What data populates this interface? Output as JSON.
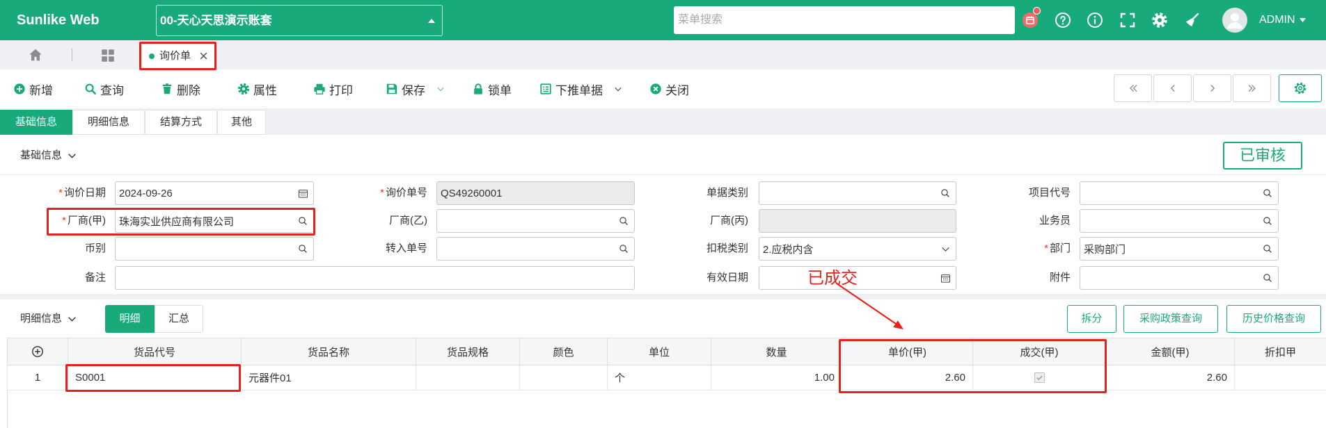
{
  "header": {
    "logo": "Sunlike Web",
    "account": "00-天心天思演示账套",
    "search_placeholder": "菜单搜索",
    "user": "ADMIN",
    "icons": [
      "calendar-notification-icon",
      "help-icon",
      "info-icon",
      "fullscreen-icon",
      "gear-icon",
      "broom-icon",
      "avatar-icon"
    ]
  },
  "tabs": [
    {
      "label": "询价单",
      "active": true
    }
  ],
  "toolbar": {
    "items": [
      {
        "label": "新增",
        "icon": "plus-circle-icon"
      },
      {
        "label": "查询",
        "icon": "search-icon"
      },
      {
        "label": "删除",
        "icon": "trash-icon"
      },
      {
        "label": "属性",
        "icon": "gear-icon"
      },
      {
        "label": "打印",
        "icon": "printer-icon"
      },
      {
        "label": "保存",
        "icon": "save-icon",
        "dropdown": true
      },
      {
        "label": "锁单",
        "icon": "lock-icon"
      },
      {
        "label": "下推单据",
        "icon": "document-list-icon",
        "dropdown": true
      },
      {
        "label": "关闭",
        "icon": "close-circle-icon"
      }
    ],
    "nav_icons": [
      "double-left-icon",
      "left-icon",
      "right-icon",
      "double-right-icon"
    ],
    "settings_icon": "gear-icon"
  },
  "form_tabs": [
    {
      "label": "基础信息",
      "active": true
    },
    {
      "label": "明细信息",
      "active": false
    },
    {
      "label": "结算方式",
      "active": false
    },
    {
      "label": "其他",
      "active": false
    }
  ],
  "basic": {
    "section_title": "基础信息",
    "status": "已审核",
    "required_mark": "*",
    "rows": [
      [
        {
          "label": "询价日期",
          "required": true,
          "value": "2024-09-26",
          "icon": "calendar-icon"
        },
        {
          "label": "询价单号",
          "required": true,
          "value": "QS49260001",
          "readonly": true
        },
        {
          "label": "单据类别",
          "value": "",
          "icon": "search-icon"
        },
        {
          "label": "项目代号",
          "value": "",
          "icon": "search-icon"
        }
      ],
      [
        {
          "label": "厂商(甲)",
          "required": true,
          "value": "珠海实业供应商有限公司",
          "icon": "search-icon"
        },
        {
          "label": "厂商(乙)",
          "value": "",
          "icon": "search-icon"
        },
        {
          "label": "厂商(丙)",
          "value": "",
          "readonly": true
        },
        {
          "label": "业务员",
          "value": "",
          "icon": "search-icon"
        }
      ],
      [
        {
          "label": "币别",
          "value": "",
          "icon": "search-icon"
        },
        {
          "label": "转入单号",
          "value": "",
          "icon": "search-icon"
        },
        {
          "label": "扣税类别",
          "value": "2.应税内含",
          "icon": "chevron-down-icon"
        },
        {
          "label": "部门",
          "required": true,
          "value": "采购部门",
          "icon": "search-icon"
        }
      ],
      [
        {
          "label": "备注",
          "value": ""
        },
        {
          "label": "有效日期",
          "value": "",
          "icon": "calendar-icon"
        },
        {
          "label": "附件",
          "value": "",
          "icon": "search-icon"
        }
      ]
    ]
  },
  "detail": {
    "section_title": "明细信息",
    "views": [
      {
        "label": "明细",
        "active": true
      },
      {
        "label": "汇总",
        "active": false
      }
    ],
    "actions": [
      "拆分",
      "采购政策查询",
      "历史价格查询"
    ],
    "columns": [
      "货品代号",
      "货品名称",
      "货品规格",
      "颜色",
      "单位",
      "数量",
      "单价(甲)",
      "成交(甲)",
      "金额(甲)",
      "折扣甲"
    ],
    "rows": [
      {
        "no": "1",
        "code": "S0001",
        "name": "元器件01",
        "spec": "",
        "color": "",
        "unit": "个",
        "qty": "1.00",
        "price": "2.60",
        "deal": true,
        "amount": "2.60",
        "discount": ""
      }
    ]
  },
  "annotations": {
    "note": "已成交"
  },
  "colors": {
    "primary": "#19aa7c",
    "annotation": "#e8201e",
    "readonly_field": "#ebebeb",
    "notification": "#f05a5a"
  }
}
